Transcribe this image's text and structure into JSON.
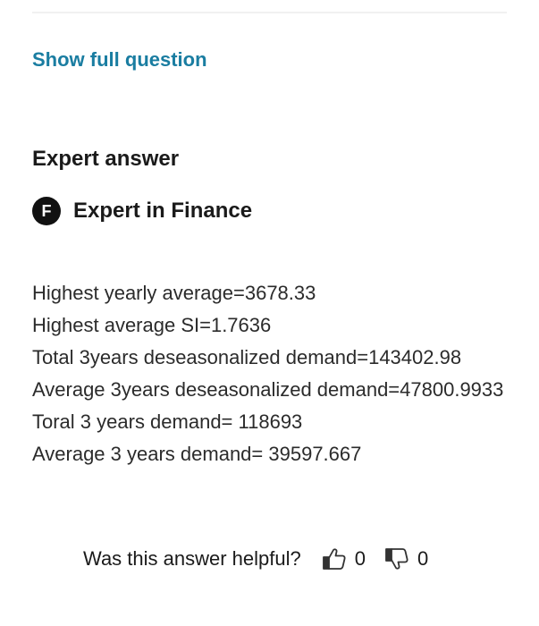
{
  "question": {
    "show_full_label": "Show full question"
  },
  "answer": {
    "heading": "Expert answer",
    "expert": {
      "avatar_letter": "F",
      "name": "Expert in Finance"
    },
    "lines": [
      "Highest yearly average=3678.33",
      "Highest average SI=1.7636",
      "Total 3years deseasonalized demand=143402.98",
      "Average 3years deseasonalized demand=47800.9933",
      "Toral 3 years demand= 118693",
      "Average 3 years demand= 39597.667"
    ]
  },
  "feedback": {
    "question": "Was this answer helpful?",
    "upvotes": "0",
    "downvotes": "0",
    "up_icon": "thumbs-up-icon",
    "down_icon": "thumbs-down-icon"
  },
  "colors": {
    "link": "#1a7da1",
    "text": "#1a1a1a",
    "avatar_bg": "#111111"
  }
}
